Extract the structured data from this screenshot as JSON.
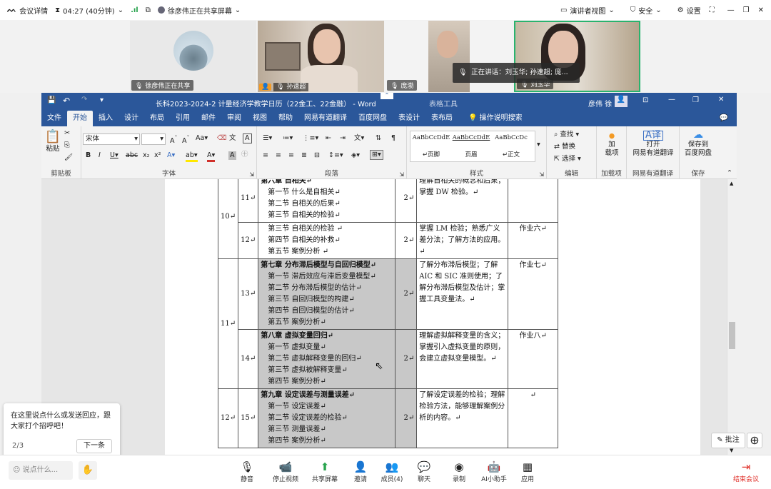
{
  "meeting": {
    "logo_label": "会议详情",
    "timer": "04:27 (40分钟)",
    "sharing_status": "徐彦伟正在共享屏幕",
    "presenter_view": "演讲者视图",
    "security": "安全",
    "settings": "设置"
  },
  "participants": [
    {
      "name": "徐彦伟正在共享"
    },
    {
      "name": "孙速超"
    },
    {
      "name": "庞渤"
    },
    {
      "name": "刘玉华"
    }
  ],
  "speaking_banner": "正在讲话：刘玉华; 孙速超; 庞...",
  "word": {
    "title": "长科2023-2024-2 计量经济学教学日历（22金工、22金融） - Word",
    "table_tools": "表格工具",
    "user": "彦伟 徐",
    "tabs": [
      "文件",
      "开始",
      "插入",
      "设计",
      "布局",
      "引用",
      "邮件",
      "审阅",
      "视图",
      "帮助",
      "网易有道翻译",
      "百度网盘",
      "表设计",
      "表布局"
    ],
    "tell_me": "操作说明搜索",
    "ribbon": {
      "paste": "粘贴",
      "clipboard": "剪贴板",
      "font_name": "宋体",
      "font_group": "字体",
      "paragraph_group": "段落",
      "styles": [
        {
          "preview": "AaBbCcDdE",
          "name": "↵页脚"
        },
        {
          "preview": "AaBbCcDdE",
          "name": "页眉"
        },
        {
          "preview": "AaBbCcDc",
          "name": "↵正文"
        }
      ],
      "styles_group": "样式",
      "find": "查找",
      "replace": "替换",
      "select": "选择",
      "editing_group": "编辑",
      "addin_label": "加\n载项",
      "addin_group": "加载项",
      "youdao_label": "打开\n网易有道翻译",
      "youdao_group": "网易有道翻译",
      "baidu_label": "保存到\n百度网盘",
      "baidu_group": "保存"
    }
  },
  "schedule_rows": [
    {
      "week": "10↵",
      "lesson": "11↵",
      "content": [
        "第六章 自相关↵",
        "第一节 什么是自相关↵",
        "第二节 自相关的后果↵",
        "第三节 自相关的检验↵"
      ],
      "hours": "2↵",
      "goal": "理解自相关的概念和后果；掌握 DW 检验。↵",
      "hw": ""
    },
    {
      "week": "",
      "lesson": "12↵",
      "content": [
        "第三节 自相关的检验 ↵",
        "第四节 自相关的补救↵",
        "第五节 案例分析 ↵"
      ],
      "hours": "2↵",
      "goal": "掌握 LM 检验；熟悉广义差分法；了解方法的应用。↵",
      "hw": "作业六↵"
    },
    {
      "week": "11↵",
      "lesson": "13↵",
      "content": [
        "第七章 分布滞后模型与自回归模型↵",
        "第一节 滞后效应与滞后变量模型↵",
        "第二节 分布滞后模型的估计↵",
        "第三节 自回归模型的构建↵",
        "第四节 自回归模型的估计↵",
        "第五节 案例分析↵"
      ],
      "hours": "2↵",
      "goal": "了解分布滞后模型；了解 AIC 和 SIC 准则使用；了解分布滞后模型及估计；掌握工具变量法。↵",
      "hw": "作业七↵"
    },
    {
      "week": "",
      "lesson": "14↵",
      "content": [
        "第八章 虚拟变量回归↵",
        "第一节 虚拟变量↵",
        "第二节 虚拟解释变量的回归↵",
        "第三节 虚拟被解释变量↵",
        "第四节 案例分析↵"
      ],
      "hours": "2↵",
      "goal": "理解虚拟解释变量的含义；掌握引入虚拟变量的原则，会建立虚拟变量模型。↵",
      "hw": "作业八↵"
    },
    {
      "week": "12↵",
      "lesson": "15↵",
      "content": [
        "第九章 设定误差与测量误差↵",
        "第一节 设定误差↵",
        "第二节 设定误差的检验↵",
        "第三节 测量误差↵",
        "第四节 案例分析↵"
      ],
      "hours": "2↵",
      "goal": "了解设定误差的检验；理解检验方法，能够理解案例分析的内容。↵",
      "hw": "↵"
    }
  ],
  "chat_popup": {
    "text": "在这里说点什么或发送回应，跟大家打个招呼吧！",
    "page": "2/3",
    "next": "下一条"
  },
  "comment_button": "批注",
  "toolbar": {
    "chat_input": "说点什么...",
    "items": [
      "静音",
      "停止视频",
      "共享屏幕",
      "邀请",
      "成员(4)",
      "聊天",
      "录制",
      "AI小助手",
      "应用"
    ],
    "end": "结束会议"
  }
}
